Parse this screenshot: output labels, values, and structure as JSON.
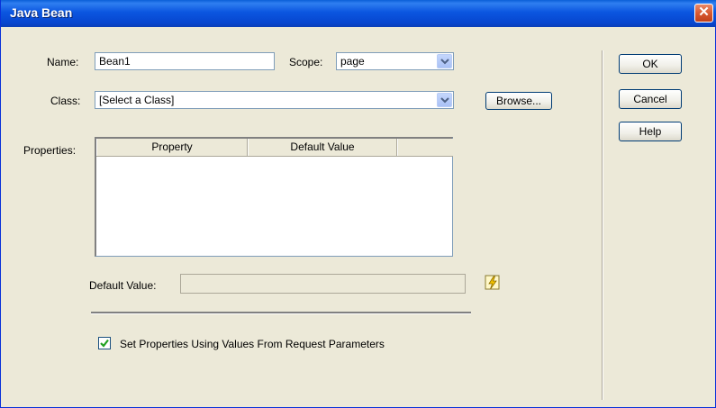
{
  "window": {
    "title": "Java Bean",
    "close_glyph": "✕"
  },
  "form": {
    "name_label": "Name:",
    "name_value": "Bean1",
    "scope_label": "Scope:",
    "scope_value": "page",
    "class_label": "Class:",
    "class_value": "[Select a Class]",
    "browse_label": "Browse...",
    "properties_label": "Properties:",
    "columns": [
      "Property",
      "Default Value"
    ],
    "default_value_label": "Default Value:",
    "default_value_value": "",
    "checkbox_label": "Set Properties Using Values From Request Parameters",
    "checkbox_checked": true
  },
  "buttons": {
    "ok": "OK",
    "cancel": "Cancel",
    "help": "Help"
  },
  "icons": {
    "close": "close-icon",
    "dropdown": "chevron-down-icon",
    "dynamic_data": "lightning-icon",
    "check": "checkmark-icon"
  },
  "colors": {
    "titlebar": "#0b56e0",
    "close": "#d85a32",
    "dialog_bg": "#ece9d8",
    "input_border": "#7f9db9",
    "button_border": "#003c74"
  }
}
